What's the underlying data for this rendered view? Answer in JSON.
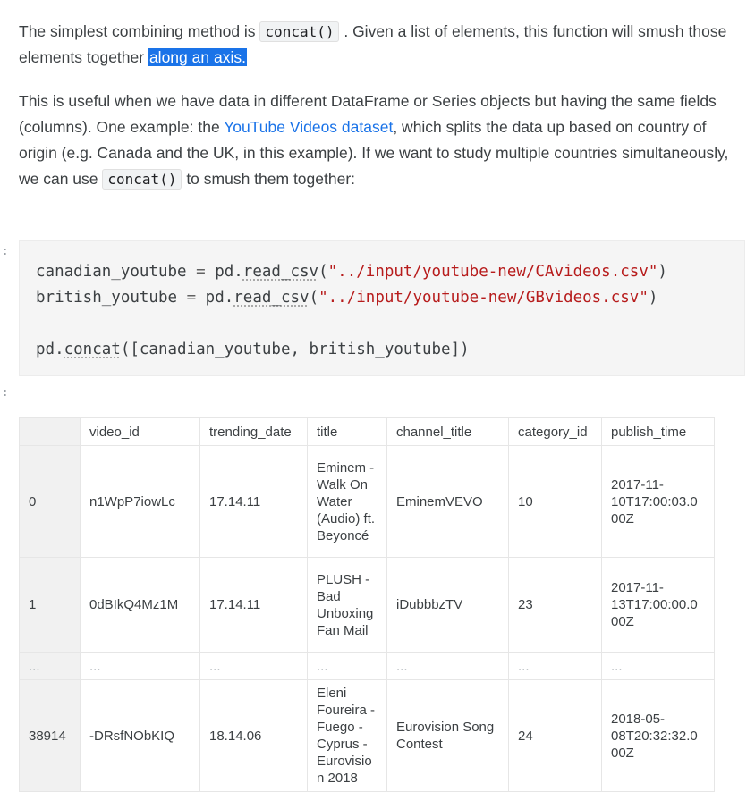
{
  "paragraph1": {
    "before": "The simplest combining method is ",
    "code": "concat()",
    "after": " . Given a list of elements, this function will smush those elements together ",
    "highlighted": "along an axis."
  },
  "paragraph2": {
    "before": "This is useful when we have data in different DataFrame or Series objects but having the same fields (columns). One example: the ",
    "link": "YouTube Videos dataset",
    "middle": ", which splits the data up based on country of origin (e.g. Canada and the UK, in this example). If we want to study multiple countries simultaneously, we can use ",
    "code": "concat()",
    "after": " to smush them together:"
  },
  "prompts": {
    "input": "]:",
    "output": "]:"
  },
  "code_cell": {
    "line1": {
      "var": "canadian_youtube",
      "op": " = ",
      "obj": "pd.",
      "fn": "read_csv",
      "open": "(",
      "str": "\"../input/youtube-new/CAvideos.csv\"",
      "close": ")"
    },
    "line2": {
      "var": "british_youtube",
      "op": " = ",
      "obj": "pd.",
      "fn": "read_csv",
      "open": "(",
      "str": "\"../input/youtube-new/GBvideos.csv\"",
      "close": ")"
    },
    "line3": {
      "obj": "pd.",
      "fn": "concat",
      "rest": "([canadian_youtube, british_youtube])"
    }
  },
  "table": {
    "columns": [
      "",
      "video_id",
      "trending_date",
      "title",
      "channel_title",
      "category_id",
      "publish_time"
    ],
    "rows": [
      [
        "0",
        "n1WpP7iowLc",
        "17.14.11",
        "Eminem - Walk On Water (Audio) ft. Beyoncé",
        "EminemVEVO",
        "10",
        "2017-11-10T17:00:03.000Z"
      ],
      [
        "1",
        "0dBIkQ4Mz1M",
        "17.14.11",
        "PLUSH - Bad Unboxing Fan Mail",
        "iDubbbzTV",
        "23",
        "2017-11-13T17:00:00.000Z"
      ],
      [
        "...",
        "...",
        "...",
        "...",
        "...",
        "...",
        "..."
      ],
      [
        "38914",
        "-DRsfNObKIQ",
        "18.14.06",
        "Eleni Foureira - Fuego - Cyprus - Eurovision 2018",
        "Eurovision Song Contest",
        "24",
        "2018-05-08T20:32:32.000Z"
      ]
    ]
  },
  "colors": {
    "link": "#1a73e8",
    "highlight": "#1a73e8",
    "string": "#b71c1c",
    "code_bg": "#f5f5f5"
  }
}
